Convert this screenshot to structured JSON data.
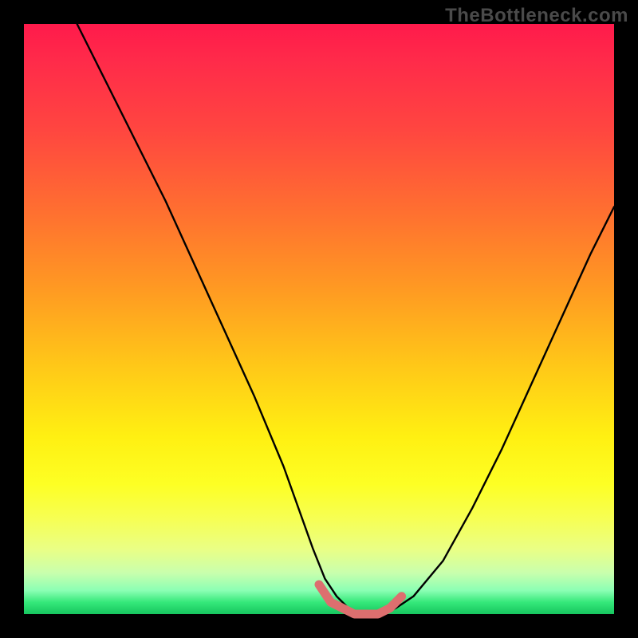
{
  "watermark": "TheBottleneck.com",
  "chart_data": {
    "type": "line",
    "title": "",
    "xlabel": "",
    "ylabel": "",
    "xlim": [
      0,
      100
    ],
    "ylim": [
      0,
      100
    ],
    "grid": false,
    "legend": false,
    "series": [
      {
        "name": "bottleneck-curve",
        "color": "#000000",
        "x": [
          9,
          14,
          19,
          24,
          29,
          34,
          39,
          44,
          49,
          51,
          53,
          55,
          57,
          59,
          61,
          63,
          66,
          71,
          76,
          81,
          86,
          91,
          96,
          100
        ],
        "y": [
          100,
          90,
          80,
          70,
          59,
          48,
          37,
          25,
          11,
          6,
          3,
          1,
          0,
          0,
          0,
          1,
          3,
          9,
          18,
          28,
          39,
          50,
          61,
          69
        ]
      },
      {
        "name": "flat-zone-highlight",
        "color": "#e07070",
        "x": [
          50,
          52,
          54,
          56,
          58,
          60,
          62,
          64
        ],
        "y": [
          5,
          2,
          1,
          0,
          0,
          0,
          1,
          3
        ]
      }
    ],
    "annotations": []
  }
}
